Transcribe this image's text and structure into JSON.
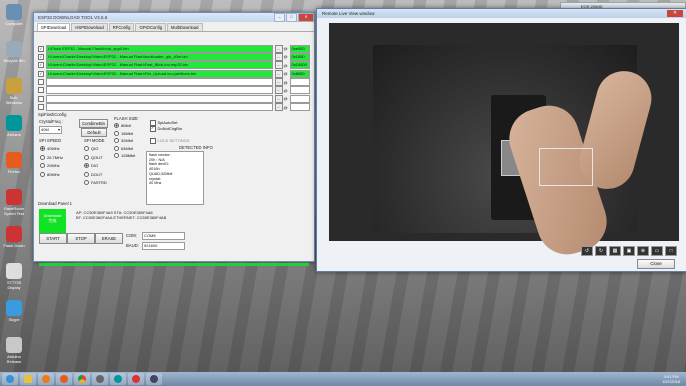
{
  "desktop": {
    "icons": [
      "Computer",
      "Recycle Bin",
      "Sub-Windows",
      "Arduino",
      "Firefox",
      "RaceRoom Speed Test",
      "Flash Down",
      "ST7735 Display",
      "Skype",
      "Arduino Release"
    ]
  },
  "esp_tool": {
    "title": "ESP32 DOWNLOAD TOOL V3.6.6",
    "tabs": [
      "SPIDownload",
      "HSPIDownload",
      "RFConfig",
      "GPIOConfig",
      "MultiDownload"
    ],
    "files": [
      {
        "path": "I:\\Flash ESP32 - Manual Flash\\boot_app0.bin",
        "addr": "0xe000",
        "checked": true,
        "green": true
      },
      {
        "path": "I:\\Users\\Charlie\\Desktop\\Video\\ESP32 - Manual Flash\\bootloader_qio_40m.bin",
        "addr": "0x1000",
        "checked": true,
        "green": true
      },
      {
        "path": "I:\\Users\\Charlie\\Desktop\\Video\\ESP32 - Manual Flash\\Fast_Blink.ino.esp32.bin",
        "addr": "0x10000",
        "checked": true,
        "green": true
      },
      {
        "path": "I:\\Users\\Charlie\\Desktop\\Video\\ESP32 - Manual Flash\\File_Upload.ino.partitions.bin",
        "addr": "0x8000",
        "checked": true,
        "green": true
      },
      {
        "path": "",
        "addr": "",
        "checked": false,
        "green": false
      },
      {
        "path": "",
        "addr": "",
        "checked": false,
        "green": false
      },
      {
        "path": "",
        "addr": "",
        "checked": false,
        "green": false
      },
      {
        "path": "",
        "addr": "",
        "checked": false,
        "green": false
      }
    ],
    "spiflash_config": "SpiFlashConfig",
    "crystal_freq_label": "CrystalFreq :",
    "crystal_freq_value": "40M",
    "combine_bin": "CombineBin",
    "default": "Default",
    "flash_size_label": "FLASH SIZE",
    "flash_sizes": [
      "8Mbit",
      "16Mbit",
      "32Mbit",
      "64Mbit",
      "128Mbit"
    ],
    "spi_auto_set": "SpiAutoSet",
    "do_not_chg_bin": "DoNotChgBin",
    "lock_settings": "LOCK SETTINGS",
    "spi_speed_label": "SPI SPEED",
    "spi_speeds": [
      "40MHz",
      "26.7MHz",
      "20MHz",
      "80MHz"
    ],
    "spi_mode_label": "SPI MODE",
    "spi_modes": [
      "QIO",
      "QOUT",
      "DIO",
      "DOUT",
      "FASTRD"
    ],
    "detected_info_label": "DETECTED INFO",
    "detected_info": [
      "flash vendor:",
      "20h : N/A",
      "flash devID:",
      "4016h",
      "QUAD;32Mbit",
      "crystal:",
      "40 Mhz"
    ],
    "download_panel": "Download Panel 1",
    "status_text": "Download",
    "status_sub": "完成",
    "ap_line": "AP:  CC50E380F4A9  STA:  CC50E380F4A8",
    "bt_line": "BT:  CC50E380F4AA  ETHERNET:  CC50E380F4AB",
    "start": "START",
    "stop": "STOP",
    "erase": "ERASE",
    "com_label": "COM:",
    "com_value": "COM8",
    "baud_label": "BAUD:",
    "baud_value": "921600",
    "progress": 1.0
  },
  "live_view": {
    "title": "Remote Live View window",
    "close": "Close",
    "eos_title": "EOS 2000D"
  },
  "taskbar": {
    "time": "4:01 PM",
    "date": "10/1/2018"
  },
  "colors": {
    "green": "#22e83a",
    "status_green": "#10e224",
    "title_blue": "#c5d7ee"
  }
}
